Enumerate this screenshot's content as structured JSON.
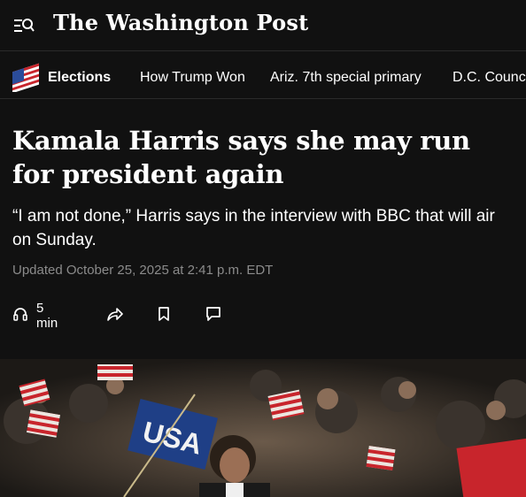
{
  "header": {
    "logo_text": "The Washington Post",
    "menu_icon": "menu-search-icon"
  },
  "nav": {
    "section_icon": "flag-icon",
    "items": [
      {
        "label": "Elections"
      },
      {
        "label": "How Trump Won"
      },
      {
        "label": "Ariz. 7th special primary"
      },
      {
        "label": "D.C. Council"
      }
    ]
  },
  "article": {
    "headline": "Kamala Harris says she may run for president again",
    "deck": "“I am not done,” Harris says in the interview with BBC that will air on Sunday.",
    "timestamp": "Updated October 25, 2025 at 2:41 p.m. EDT"
  },
  "actions": {
    "listen_label": "5 min",
    "icons": [
      "headphones-icon",
      "share-icon",
      "bookmark-icon",
      "comment-icon"
    ]
  },
  "photo": {
    "sign_text": "USA",
    "colors": {
      "background": "#111111",
      "muted": "#8b8b8b",
      "sign_blue": "#1f3f86",
      "flag_red": "#c8252c"
    }
  }
}
